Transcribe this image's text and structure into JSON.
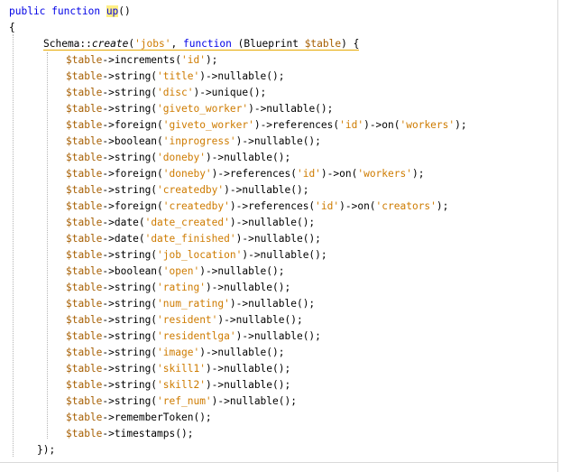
{
  "code": {
    "kw_public": "public",
    "kw_function": "function",
    "fn_name": "up",
    "parens": "()",
    "open_brace": "{",
    "schema_prefix": "Schema::",
    "schema_method": "create",
    "schema_open": "(",
    "schema_table": "'jobs'",
    "schema_comma": ", ",
    "schema_kw_function": "function",
    "schema_param": " (Blueprint ",
    "schema_var": "$table",
    "schema_close": ")",
    "schema_brace": " {",
    "close_inner": "});",
    "statements": [
      {
        "var": "$table",
        "method": "->increments(",
        "arg": "'id'",
        "rest": ");"
      },
      {
        "var": "$table",
        "method": "->string(",
        "arg": "'title'",
        "rest": ")->nullable();"
      },
      {
        "var": "$table",
        "method": "->string(",
        "arg": "'disc'",
        "rest": ")->unique();"
      },
      {
        "var": "$table",
        "method": "->string(",
        "arg": "'giveto_worker'",
        "rest": ")->nullable();"
      },
      {
        "var": "$table",
        "method": "->foreign(",
        "arg": "'giveto_worker'",
        "rest": ")->references(",
        "arg2": "'id'",
        "rest2": ")->on(",
        "arg3": "'workers'",
        "rest3": ");"
      },
      {
        "var": "$table",
        "method": "->boolean(",
        "arg": "'inprogress'",
        "rest": ")->nullable();"
      },
      {
        "var": "$table",
        "method": "->string(",
        "arg": "'doneby'",
        "rest": ")->nullable();"
      },
      {
        "var": "$table",
        "method": "->foreign(",
        "arg": "'doneby'",
        "rest": ")->references(",
        "arg2": "'id'",
        "rest2": ")->on(",
        "arg3": "'workers'",
        "rest3": ");"
      },
      {
        "var": "$table",
        "method": "->string(",
        "arg": "'createdby'",
        "rest": ")->nullable();"
      },
      {
        "var": "$table",
        "method": "->foreign(",
        "arg": "'createdby'",
        "rest": ")->references(",
        "arg2": "'id'",
        "rest2": ")->on(",
        "arg3": "'creators'",
        "rest3": ");"
      },
      {
        "var": "$table",
        "method": "->date(",
        "arg": "'date_created'",
        "rest": ")->nullable();"
      },
      {
        "var": "$table",
        "method": "->date(",
        "arg": "'date_finished'",
        "rest": ")->nullable();"
      },
      {
        "var": "$table",
        "method": "->string(",
        "arg": "'job_location'",
        "rest": ")->nullable();"
      },
      {
        "var": "$table",
        "method": "->boolean(",
        "arg": "'open'",
        "rest": ")->nullable();"
      },
      {
        "var": "$table",
        "method": "->string(",
        "arg": "'rating'",
        "rest": ")->nullable();"
      },
      {
        "var": "$table",
        "method": "->string(",
        "arg": "'num_rating'",
        "rest": ")->nullable();"
      },
      {
        "var": "$table",
        "method": "->string(",
        "arg": "'resident'",
        "rest": ")->nullable();"
      },
      {
        "var": "$table",
        "method": "->string(",
        "arg": "'residentlga'",
        "rest": ")->nullable();"
      },
      {
        "var": "$table",
        "method": "->string(",
        "arg": "'image'",
        "rest": ")->nullable();"
      },
      {
        "var": "$table",
        "method": "->string(",
        "arg": "'skill1'",
        "rest": ")->nullable();"
      },
      {
        "var": "$table",
        "method": "->string(",
        "arg": "'skill2'",
        "rest": ")->nullable();"
      },
      {
        "var": "$table",
        "method": "->string(",
        "arg": "'ref_num'",
        "rest": ")->nullable();"
      },
      {
        "var": "$table",
        "method": "->rememberToken();"
      },
      {
        "var": "$table",
        "method": "->timestamps();"
      }
    ]
  },
  "colors": {
    "keyword": "#0000e6",
    "string": "#ce7b00",
    "variable": "#a65e00",
    "highlight": "#ffef84"
  }
}
